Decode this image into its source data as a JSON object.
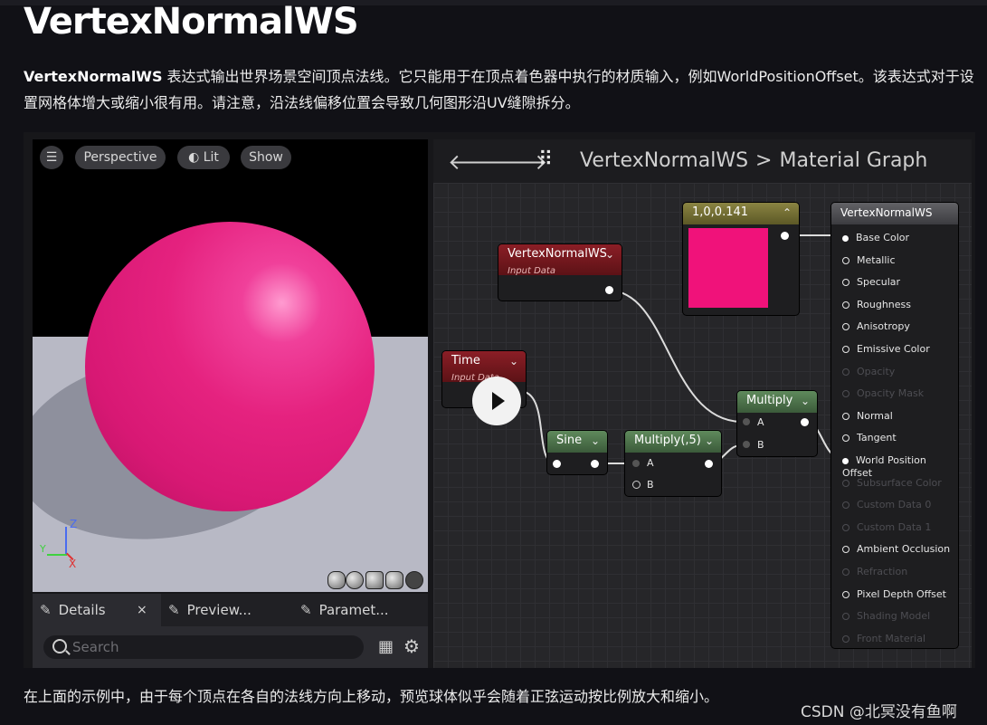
{
  "page": {
    "title": "VertexNormalWS",
    "para_bold": "VertexNormalWS",
    "para_rest": " 表达式输出世界场景空间顶点法线。它只能用于在顶点着色器中执行的材质输入，例如WorldPositionOffset。该表达式对于设置网格体增大或缩小很有用。请注意，沿法线偏移位置会导致几何图形沿UV缝隙拆分。",
    "caption": "在上面的示例中，由于每个顶点在各自的法线方向上移动，预览球体似乎会随着正弦运动按比例放大和缩小。",
    "watermark": "CSDN @北冥没有鱼啊"
  },
  "viewport": {
    "perspective": "Perspective",
    "lit": "Lit",
    "show": "Show",
    "axis_z": "Z",
    "axis_y": "Y",
    "axis_x": "X"
  },
  "details": {
    "tab_details": "Details",
    "tab_close": "×",
    "tab_preview": "Preview...",
    "tab_param": "Paramet...",
    "search_placeholder": "Search"
  },
  "graph": {
    "breadcrumb_root": "VertexNormalWS",
    "breadcrumb_sep": ">",
    "breadcrumb_leaf": "Material Graph",
    "vn_node": {
      "title": "VertexNormalWS",
      "subtitle": "Input Data"
    },
    "time_node": {
      "title": "Time",
      "subtitle": "Input Data"
    },
    "color_node": {
      "title": "1,0,0.141",
      "color": "#f0127a"
    },
    "sine_node": {
      "title": "Sine"
    },
    "mult5_node": {
      "title": "Multiply(,5)",
      "pin_a": "A",
      "pin_b": "B"
    },
    "mult_node": {
      "title": "Multiply",
      "pin_a": "A",
      "pin_b": "B"
    },
    "result_node": {
      "title": "VertexNormalWS",
      "attributes": [
        {
          "label": "Base Color",
          "active": true,
          "filled": true
        },
        {
          "label": "Metallic",
          "active": true,
          "filled": false
        },
        {
          "label": "Specular",
          "active": true,
          "filled": false
        },
        {
          "label": "Roughness",
          "active": true,
          "filled": false
        },
        {
          "label": "Anisotropy",
          "active": true,
          "filled": false
        },
        {
          "label": "Emissive Color",
          "active": true,
          "filled": false
        },
        {
          "label": "Opacity",
          "active": false,
          "filled": false
        },
        {
          "label": "Opacity Mask",
          "active": false,
          "filled": false
        },
        {
          "label": "Normal",
          "active": true,
          "filled": false
        },
        {
          "label": "Tangent",
          "active": true,
          "filled": false
        },
        {
          "label": "World Position Offset",
          "active": true,
          "filled": true
        },
        {
          "label": "Subsurface Color",
          "active": false,
          "filled": false
        },
        {
          "label": "Custom Data 0",
          "active": false,
          "filled": false
        },
        {
          "label": "Custom Data 1",
          "active": false,
          "filled": false
        },
        {
          "label": "Ambient Occlusion",
          "active": true,
          "filled": false
        },
        {
          "label": "Refraction",
          "active": false,
          "filled": false
        },
        {
          "label": "Pixel Depth Offset",
          "active": true,
          "filled": false
        },
        {
          "label": "Shading Model",
          "active": false,
          "filled": false
        },
        {
          "label": "Front Material",
          "active": false,
          "filled": false
        }
      ]
    }
  },
  "colors": {
    "sphere": "#e5227f",
    "input_node_header": "#7a1a1f",
    "math_node_header": "#466b46",
    "constant_node_header": "#6e6a34",
    "result_node_header": "#4b4b4e"
  }
}
